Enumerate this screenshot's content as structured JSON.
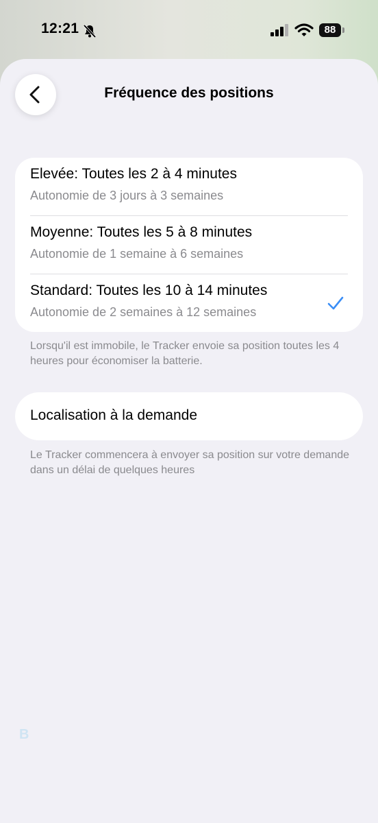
{
  "status_bar": {
    "time": "12:21",
    "battery": "88"
  },
  "header": {
    "title": "Fréquence des positions"
  },
  "frequency_options": [
    {
      "title": "Elevée: Toutes les 2 à 4 minutes",
      "subtitle": "Autonomie de 3 jours à 3 semaines",
      "selected": false
    },
    {
      "title": "Moyenne: Toutes les 5 à 8 minutes",
      "subtitle": "Autonomie de 1 semaine à 6 semaines",
      "selected": false
    },
    {
      "title": "Standard: Toutes les 10 à 14 minutes",
      "subtitle": "Autonomie de 2 semaines à 12 semaines",
      "selected": true
    }
  ],
  "frequency_note": "Lorsqu'il est immobile, le Tracker envoie sa position toutes les 4 heures pour économiser la batterie.",
  "on_demand": {
    "label": "Localisation à la demande",
    "note": "Le Tracker commencera à envoyer sa position sur votre demande dans un délai de quelques heures"
  },
  "watermark": "B",
  "colors": {
    "accent": "#3a8ef6",
    "background": "#f1f0f6",
    "card": "#ffffff",
    "secondary_text": "#8a8a8e"
  }
}
